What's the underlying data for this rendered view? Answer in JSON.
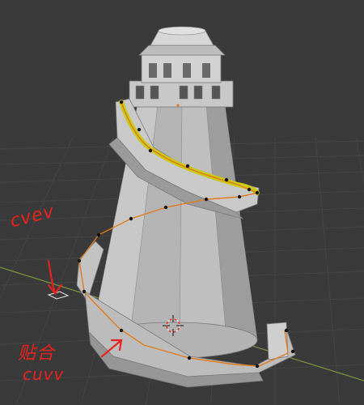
{
  "viewport": {
    "background": "#3a3a3a",
    "grid_color": "#454545",
    "x_axis_color": "#8aa04a",
    "path_color": "#e07b1e",
    "selected_path_color": "#c9c917",
    "annotation_color": "#e8231f"
  },
  "annotations": {
    "label_top": "cvev",
    "label_bottom_1": "贴合",
    "label_bottom_2": "cuvv"
  },
  "icons": {
    "cursor": "3d-cursor-icon",
    "empty_object": "empty-object-icon"
  }
}
